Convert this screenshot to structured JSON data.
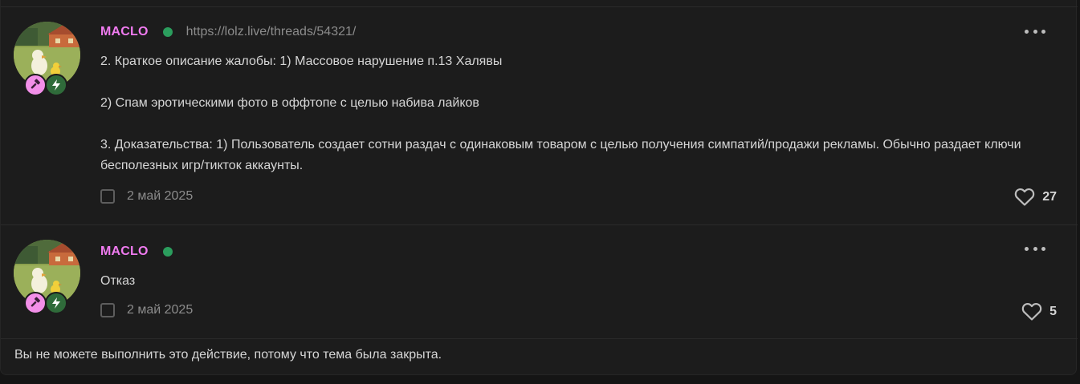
{
  "posts": [
    {
      "username": "MACLO",
      "link": "https://lolz.live/threads/54321/",
      "paragraphs": [
        "2. Краткое описание жалобы: 1) Массовое нарушение п.13 Халявы",
        "2) Спам эротическими фото в оффтопе с целью набива лайков",
        "3. Доказательства: 1) Пользователь создает сотни раздач с одинаковым товаром с целью получения симпатий/продажи рекламы. Обычно раздает ключи бесполезных игр/тикток аккаунты."
      ],
      "date": "2 май 2025",
      "likes": "27"
    },
    {
      "username": "MACLO",
      "paragraphs": [
        "Отказ"
      ],
      "date": "2 май 2025",
      "likes": "5"
    }
  ],
  "notice": "Вы не можете выполнить это действие, потому что тема была закрыта.",
  "icons": {
    "badge_1": "gavel-icon",
    "badge_2": "lightning-bolt-icon",
    "menu": "more-dots-icon",
    "like": "heart-icon"
  },
  "colors": {
    "username": "#f07bf0",
    "online": "#2b9d5d",
    "badge_1": "#f28fe8",
    "badge_2": "#2f6b3a",
    "background": "#1c1c1c"
  }
}
